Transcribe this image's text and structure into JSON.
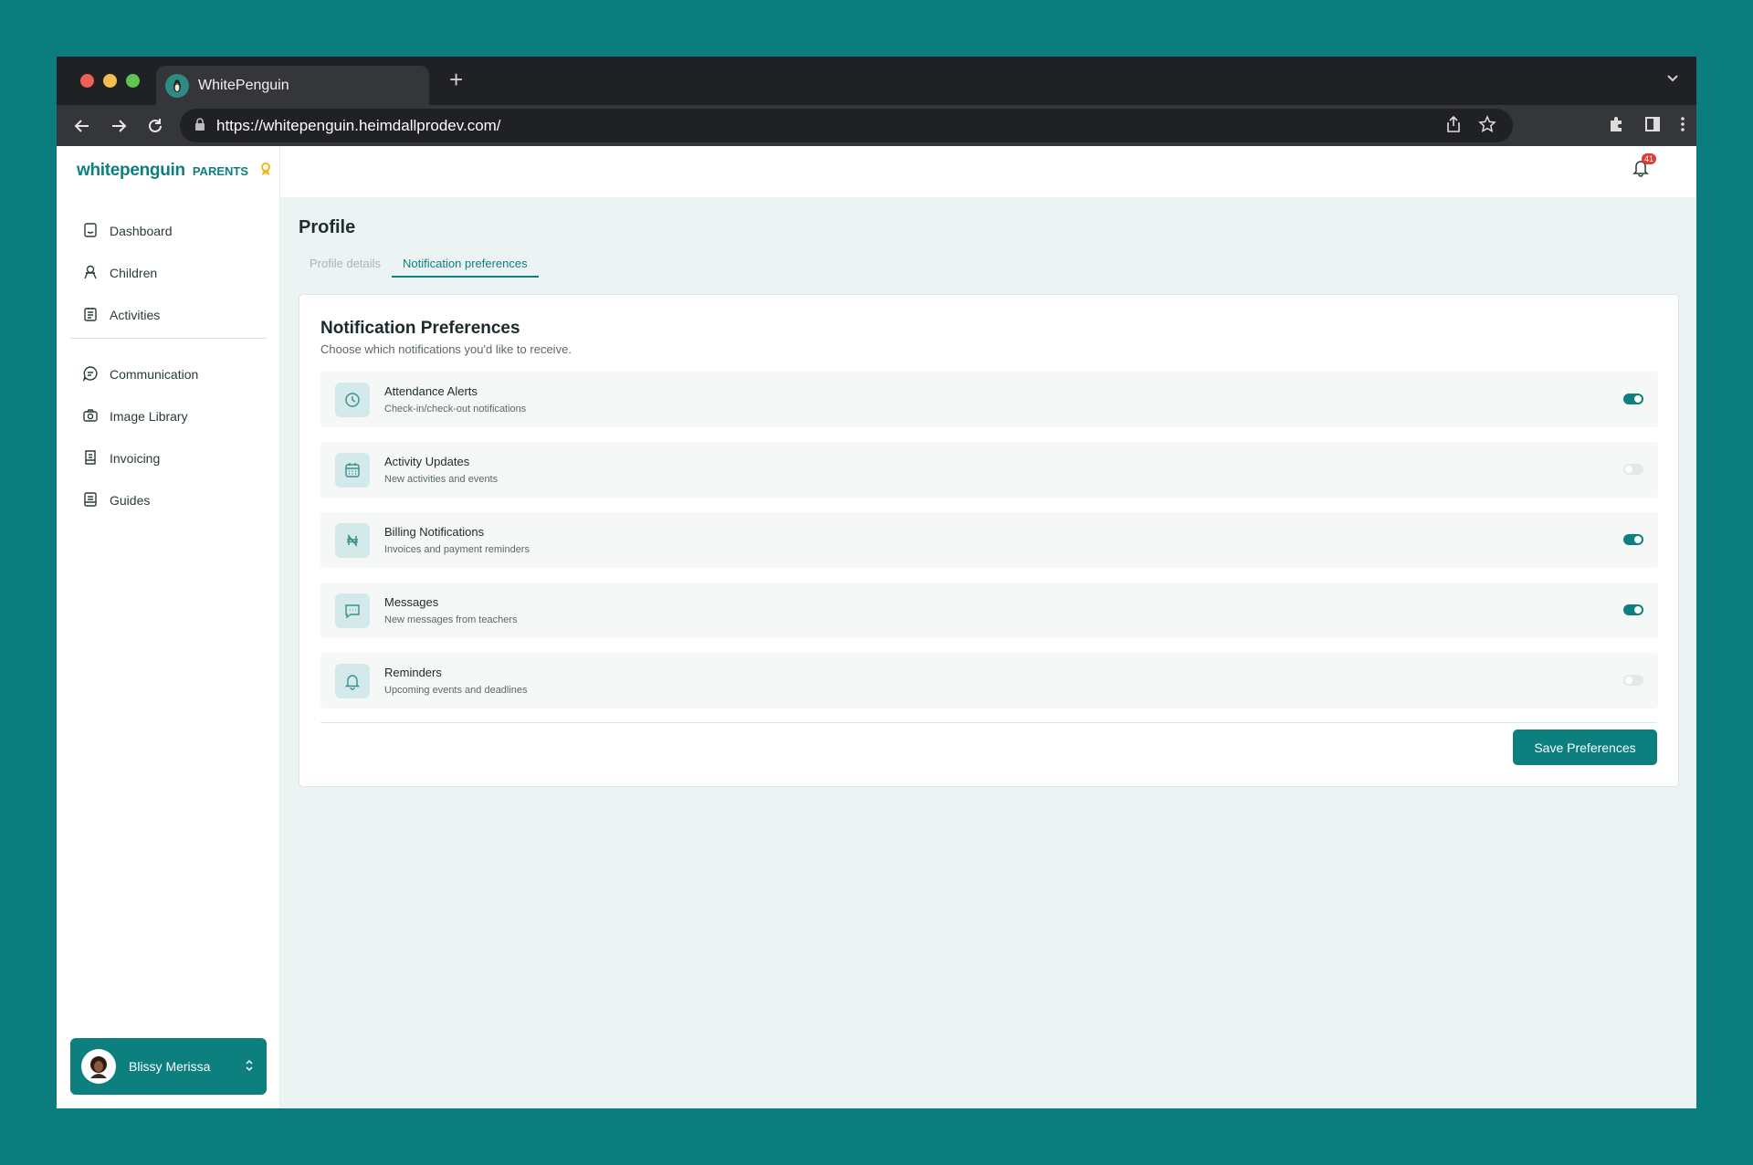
{
  "browser": {
    "tab_title": "WhitePenguin",
    "new_tab_label": "+",
    "url": "https://whitepenguin.heimdallprodev.com/"
  },
  "sidebar": {
    "brand_name": "whitepenguin",
    "brand_suffix": "PARENTS",
    "items_primary": [
      {
        "label": "Dashboard",
        "icon": "dashboard-icon"
      },
      {
        "label": "Children",
        "icon": "children-icon"
      },
      {
        "label": "Activities",
        "icon": "activities-icon"
      }
    ],
    "items_secondary": [
      {
        "label": "Communication",
        "icon": "chat-icon"
      },
      {
        "label": "Image Library",
        "icon": "camera-icon"
      },
      {
        "label": "Invoicing",
        "icon": "invoice-icon"
      },
      {
        "label": "Guides",
        "icon": "book-icon"
      }
    ],
    "user_name": "Blissy Merissa"
  },
  "header": {
    "notification_count": "41"
  },
  "main": {
    "page_title": "Profile",
    "tabs": [
      {
        "label": "Profile details",
        "active": false
      },
      {
        "label": "Notification preferences",
        "active": true
      }
    ],
    "card_title": "Notification Preferences",
    "card_subtitle": "Choose which notifications you'd like to receive.",
    "preferences": [
      {
        "label": "Attendance Alerts",
        "description": "Check-in/check-out notifications",
        "icon": "clock-icon",
        "enabled": true
      },
      {
        "label": "Activity Updates",
        "description": "New activities and events",
        "icon": "calendar-icon",
        "enabled": false
      },
      {
        "label": "Billing Notifications",
        "description": "Invoices and payment reminders",
        "icon": "currency-icon",
        "enabled": true
      },
      {
        "label": "Messages",
        "description": "New messages from teachers",
        "icon": "message-icon",
        "enabled": true
      },
      {
        "label": "Reminders",
        "description": "Upcoming events and deadlines",
        "icon": "bell-icon",
        "enabled": false
      }
    ],
    "save_label": "Save Preferences"
  },
  "colors": {
    "accent": "#0d7f7f",
    "background": "#0b7d7f",
    "toggle_off": "#e3e8e8"
  }
}
